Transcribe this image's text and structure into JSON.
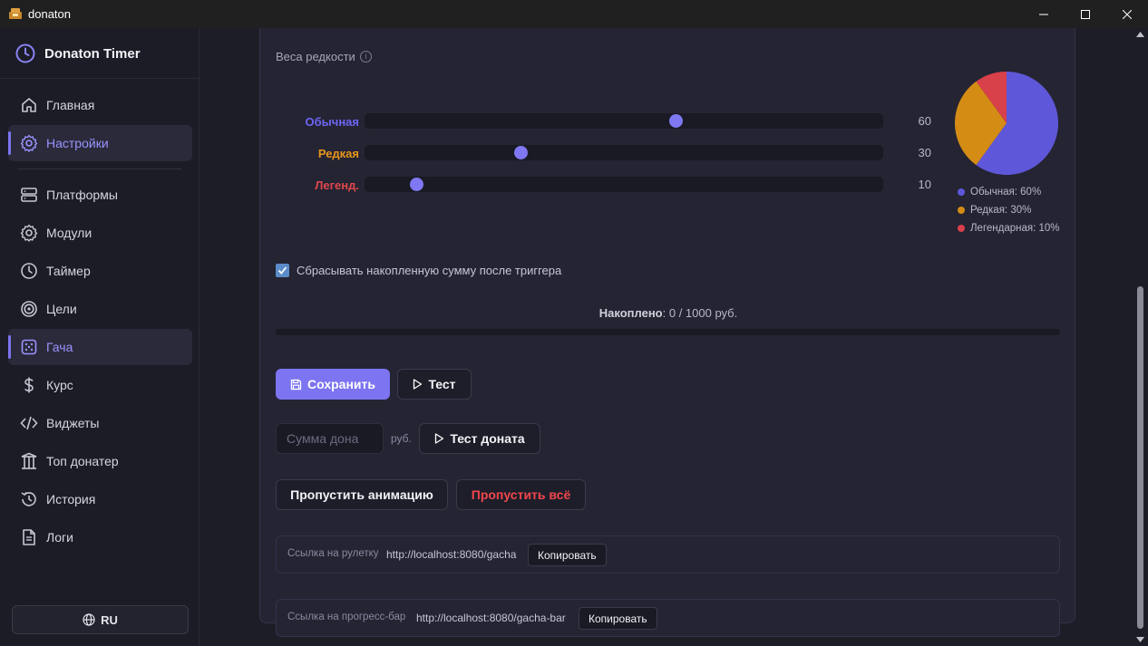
{
  "window": {
    "title": "donaton"
  },
  "sidebar": {
    "brand": "Donaton Timer",
    "items": [
      {
        "label": "Главная",
        "icon": "home-icon"
      },
      {
        "label": "Настройки",
        "icon": "gear-icon",
        "active": true
      },
      {
        "label": "Платформы",
        "icon": "server-icon"
      },
      {
        "label": "Модули",
        "icon": "gear-icon"
      },
      {
        "label": "Таймер",
        "icon": "clock-icon"
      },
      {
        "label": "Цели",
        "icon": "target-icon"
      },
      {
        "label": "Гача",
        "icon": "dice-icon",
        "active": true
      },
      {
        "label": "Курс",
        "icon": "dollar-icon"
      },
      {
        "label": "Виджеты",
        "icon": "code-icon"
      },
      {
        "label": "Топ донатер",
        "icon": "columns-icon"
      },
      {
        "label": "История",
        "icon": "history-icon"
      },
      {
        "label": "Логи",
        "icon": "file-icon"
      }
    ],
    "language": "RU"
  },
  "rarity": {
    "section_title": "Веса редкости",
    "rows": [
      {
        "label": "Обычная",
        "value": 60,
        "color": "#6d66f5"
      },
      {
        "label": "Редкая",
        "value": 30,
        "color": "#e8961c"
      },
      {
        "label": "Легенд.",
        "value": 10,
        "color": "#e0474c"
      }
    ],
    "slider_max": 100,
    "pie": [
      {
        "label": "Обычная: 60%",
        "value": 60,
        "color": "#5f57d9"
      },
      {
        "label": "Редкая: 30%",
        "value": 30,
        "color": "#d48c15"
      },
      {
        "label": "Легендарная: 10%",
        "value": 10,
        "color": "#d8404a"
      }
    ]
  },
  "reset": {
    "checked": true,
    "label": "Сбрасывать накопленную сумму после триггера"
  },
  "accumulated": {
    "label": "Накоплено",
    "value": ": 0 / 1000 руб.",
    "progress": 0
  },
  "actions": {
    "save_label": "Сохранить",
    "test_label": "Тест",
    "donate_placeholder": "Сумма дона",
    "unit": "руб.",
    "test_donate_label": "Тест доната",
    "skip_anim_label": "Пропустить анимацию",
    "skip_all_label": "Пропустить всё"
  },
  "links": [
    {
      "label": "Ссылка на рулетку",
      "url": "http://localhost:8080/gacha",
      "copy": "Копировать"
    },
    {
      "label": "Ссылка на прогресс-бар",
      "url": "http://localhost:8080/gacha-bar",
      "copy": "Копировать"
    }
  ],
  "colors": {
    "accent": "#7c74f0",
    "danger": "#f0474c"
  }
}
